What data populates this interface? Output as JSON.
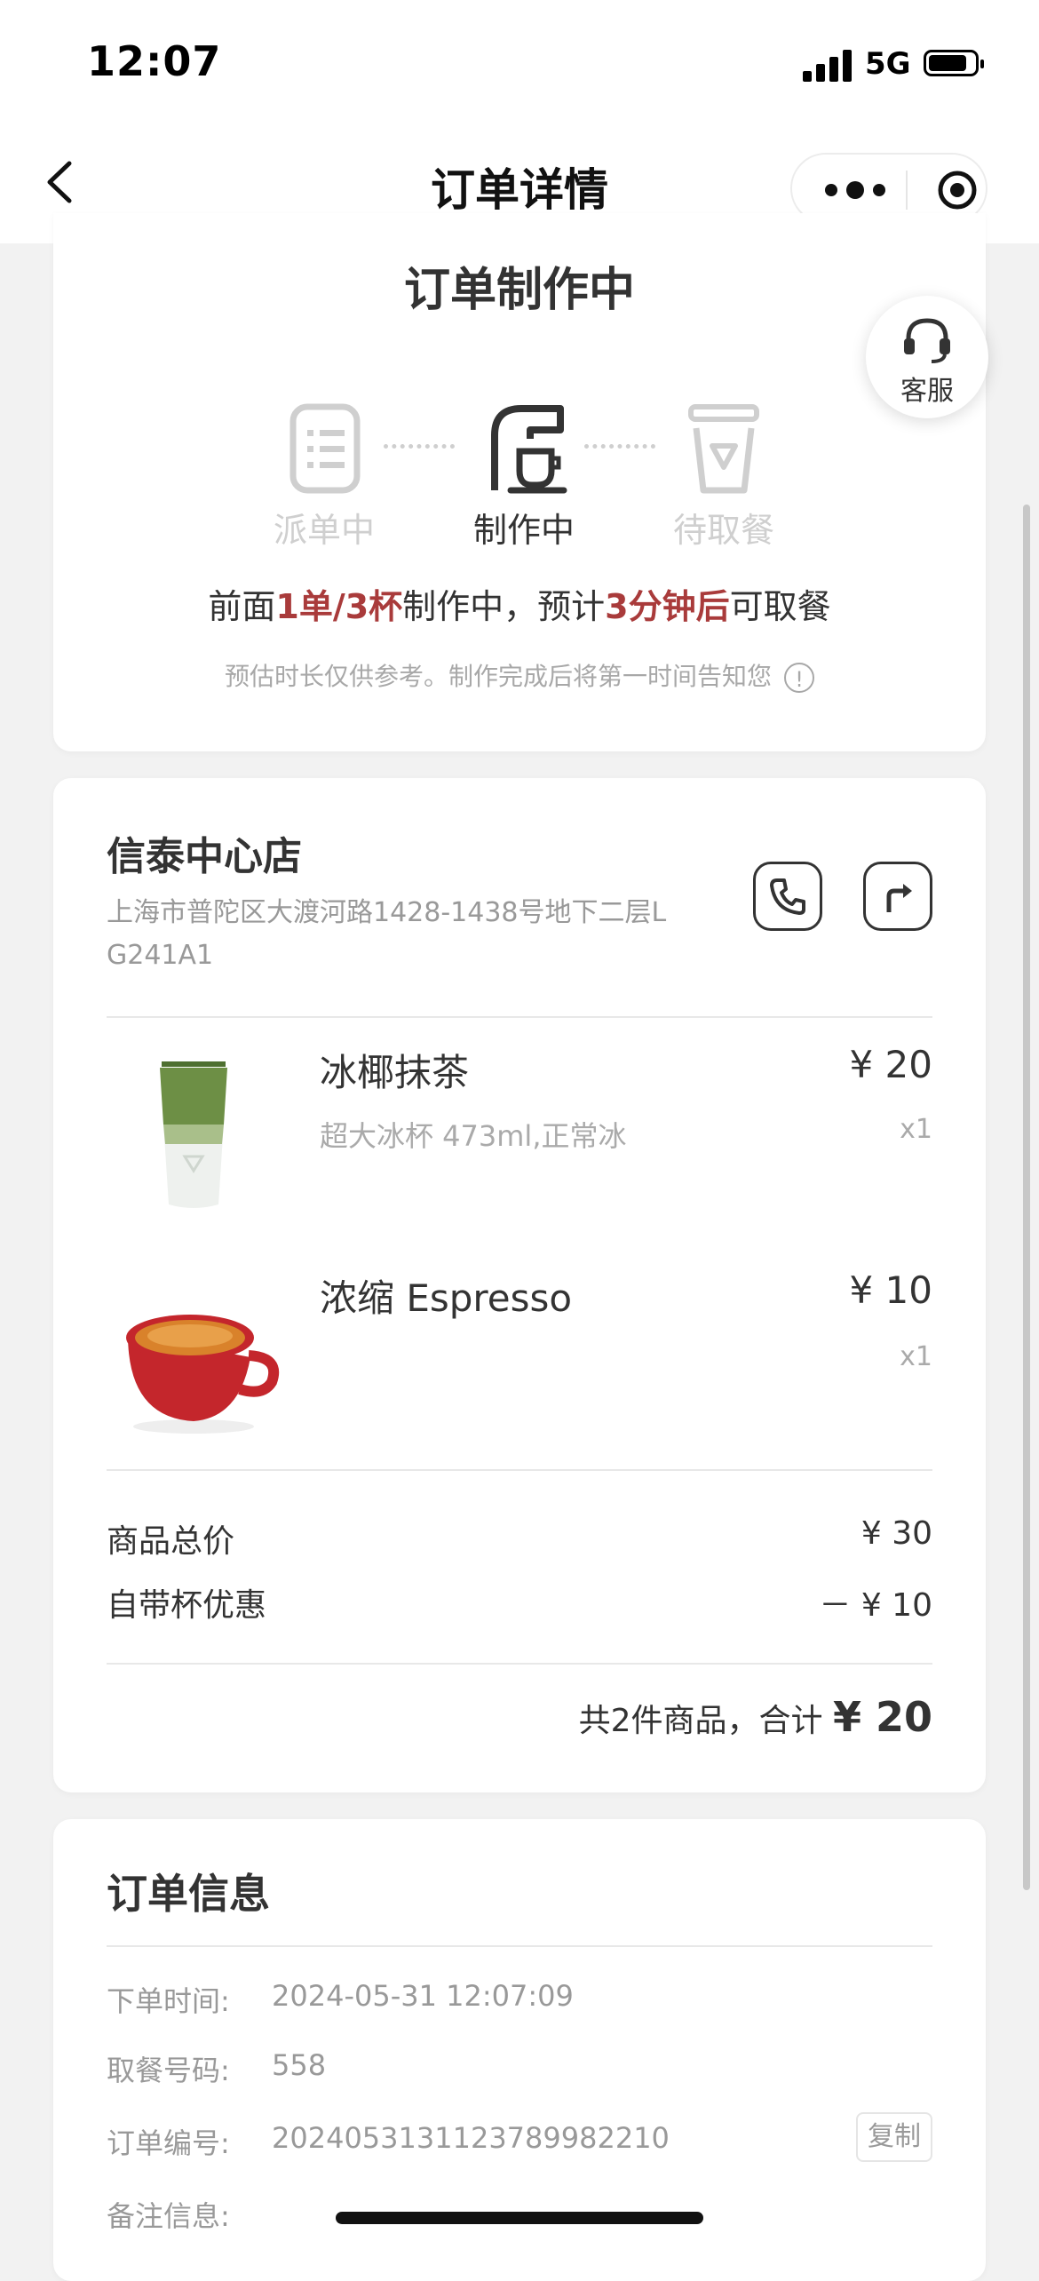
{
  "status_bar": {
    "time": "12:07",
    "network": "5G"
  },
  "nav": {
    "title": "订单详情"
  },
  "order_status": {
    "title": "订单制作中",
    "steps": [
      {
        "label": "派单中",
        "state": "done"
      },
      {
        "label": "制作中",
        "state": "active"
      },
      {
        "label": "待取餐",
        "state": "pending"
      }
    ],
    "progress": {
      "prefix": "前面",
      "queue": "1单/3杯",
      "mid": "制作中，预计",
      "eta": "3分钟后",
      "suffix": "可取餐"
    },
    "note": "预估时长仅供参考。制作完成后将第一时间告知您"
  },
  "service": {
    "label": "客服"
  },
  "store": {
    "name": "信泰中心店",
    "address": "上海市普陀区大渡河路1428-1438号地下二层L G241A1"
  },
  "items": [
    {
      "name": "冰椰抹茶",
      "spec": "超大冰杯 473ml,正常冰",
      "price": "¥ 20",
      "qty": "x1"
    },
    {
      "name": "浓缩 Espresso",
      "spec": "",
      "price": "¥ 10",
      "qty": "x1"
    }
  ],
  "fees": [
    {
      "label": "商品总价",
      "value": "¥ 30"
    },
    {
      "label": "自带杯优惠",
      "value": "－ ¥ 10"
    }
  ],
  "summary": {
    "text": "共2件商品，合计",
    "amount": "¥ 20"
  },
  "order_info": {
    "title": "订单信息",
    "rows": [
      {
        "label": "下单时间:",
        "value": "2024-05-31 12:07:09"
      },
      {
        "label": "取餐号码:",
        "value": "558"
      },
      {
        "label": "订单编号:",
        "value": "20240531311237899822​10"
      },
      {
        "label": "备注信息:",
        "value": ""
      }
    ],
    "copy_label": "复制"
  },
  "colors": {
    "accent": "#a93b3b",
    "icon_inactive": "#cfcfcf",
    "icon_active": "#333333"
  }
}
